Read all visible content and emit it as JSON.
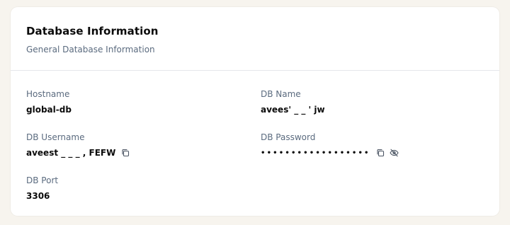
{
  "header": {
    "title": "Database Information",
    "subtitle": "General Database Information"
  },
  "fields": {
    "hostname": {
      "label": "Hostname",
      "value": "global-db"
    },
    "db_name": {
      "label": "DB Name",
      "value": "avees'  _   _  '  jw"
    },
    "db_username": {
      "label": "DB Username",
      "value": "aveest  _  _  _  ,  FEFW"
    },
    "db_password": {
      "label": "DB Password",
      "value": "••••••••••••••••••"
    },
    "db_port": {
      "label": "DB Port",
      "value": "3306"
    }
  },
  "icons": {
    "copy": "copy-icon",
    "hide": "eye-off-icon"
  },
  "colors": {
    "background": "#f7f4ee",
    "card": "#ffffff",
    "label": "#5b6b7f",
    "divider": "#e5e7eb"
  }
}
